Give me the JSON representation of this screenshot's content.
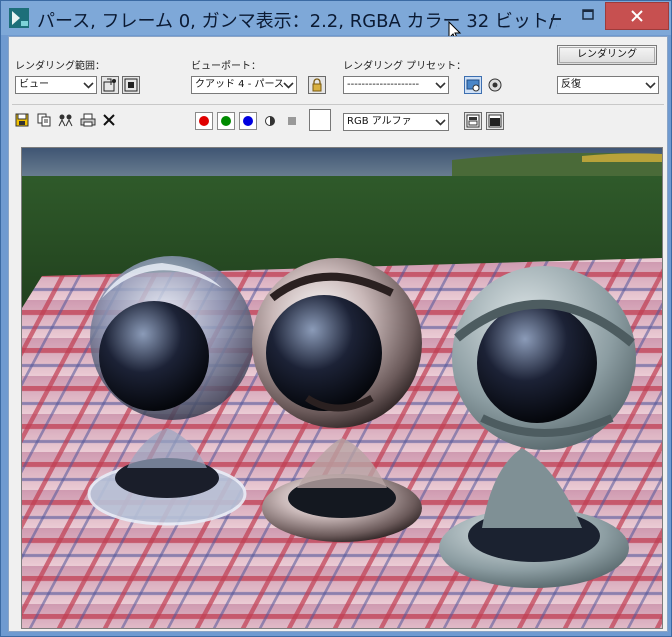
{
  "window": {
    "title": "パース, フレーム 0, ガンマ表示：2.2, RGBA カラー 32 ビット/...",
    "minimize_icon": "minimize-icon",
    "maximize_icon": "maximize-icon",
    "close_icon": "close-icon"
  },
  "controls": {
    "render_area_label": "レンダリング範囲：",
    "render_area_value": "ビュー",
    "viewport_label": "ビューポート：",
    "viewport_value": "クアッド 4 - パース",
    "preset_label": "レンダリング プリセット：",
    "preset_value": "--------------------",
    "render_button": "レンダリング",
    "render_mode_value": "反復",
    "channel_value": "RGB アルファ"
  },
  "toolbar_icons": [
    "save-image-icon",
    "copy-image-icon",
    "clone-frame-icon",
    "print-icon",
    "clear-icon"
  ],
  "channels": {
    "red": "#e00000",
    "green": "#008a00",
    "blue": "#0000e0"
  },
  "colors": {
    "titlebar": "#7ea8d8",
    "close_button": "#c75050",
    "panel": "#f0f0f0"
  }
}
